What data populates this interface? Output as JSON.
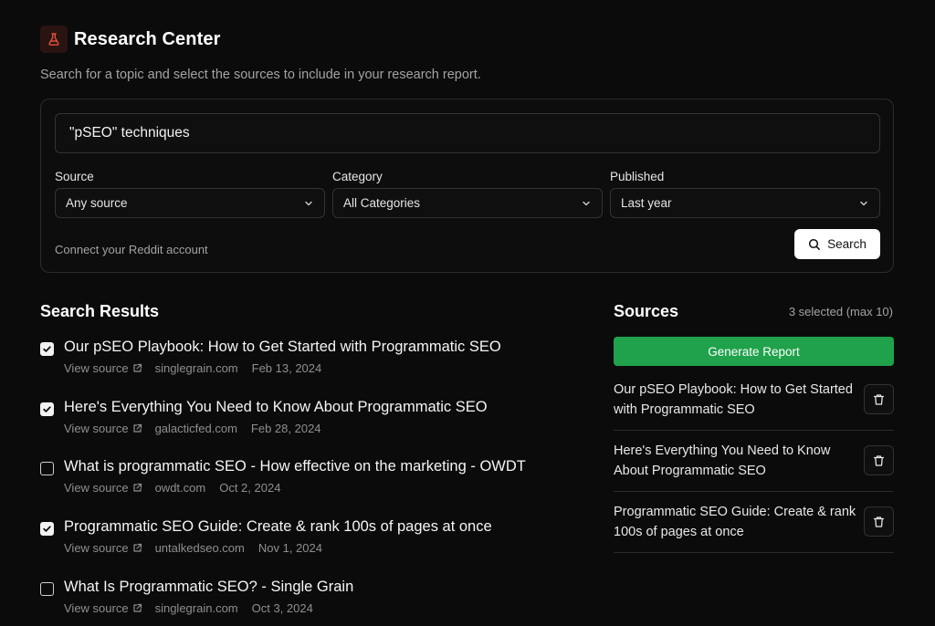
{
  "header": {
    "logo_icon": "flask-icon",
    "title": "Research Center",
    "subtitle": "Search for a topic and select the sources to include in your research report."
  },
  "search": {
    "query": "\"pSEO\" techniques",
    "filters": {
      "source": {
        "label": "Source",
        "value": "Any source"
      },
      "category": {
        "label": "Category",
        "value": "All Categories"
      },
      "published": {
        "label": "Published",
        "value": "Last year"
      }
    },
    "connect_link": "Connect your Reddit account",
    "button_label": "Search"
  },
  "results": {
    "heading": "Search Results",
    "view_source_label": "View source",
    "items": [
      {
        "title": "Our pSEO Playbook: How to Get Started with Programmatic SEO",
        "domain": "singlegrain.com",
        "date": "Feb 13, 2024",
        "checked": true
      },
      {
        "title": "Here's Everything You Need to Know About Programmatic SEO",
        "domain": "galacticfed.com",
        "date": "Feb 28, 2024",
        "checked": true
      },
      {
        "title": "What is programmatic SEO - How effective on the marketing - OWDT",
        "domain": "owdt.com",
        "date": "Oct 2, 2024",
        "checked": false
      },
      {
        "title": "Programmatic SEO Guide: Create & rank 100s of pages at once",
        "domain": "untalkedseo.com",
        "date": "Nov 1, 2024",
        "checked": true
      },
      {
        "title": "What Is Programmatic SEO? - Single Grain",
        "domain": "singlegrain.com",
        "date": "Oct 3, 2024",
        "checked": false
      }
    ]
  },
  "sources": {
    "heading": "Sources",
    "count_text": "3 selected (max 10)",
    "generate_label": "Generate Report",
    "items": [
      {
        "title": "Our pSEO Playbook: How to Get Started with Programmatic SEO"
      },
      {
        "title": "Here's Everything You Need to Know About Programmatic SEO"
      },
      {
        "title": "Programmatic SEO Guide: Create & rank 100s of pages at once"
      }
    ]
  },
  "colors": {
    "background": "#0b0b0b",
    "accent_green": "#1fa24b",
    "logo_red": "#e0523a"
  }
}
